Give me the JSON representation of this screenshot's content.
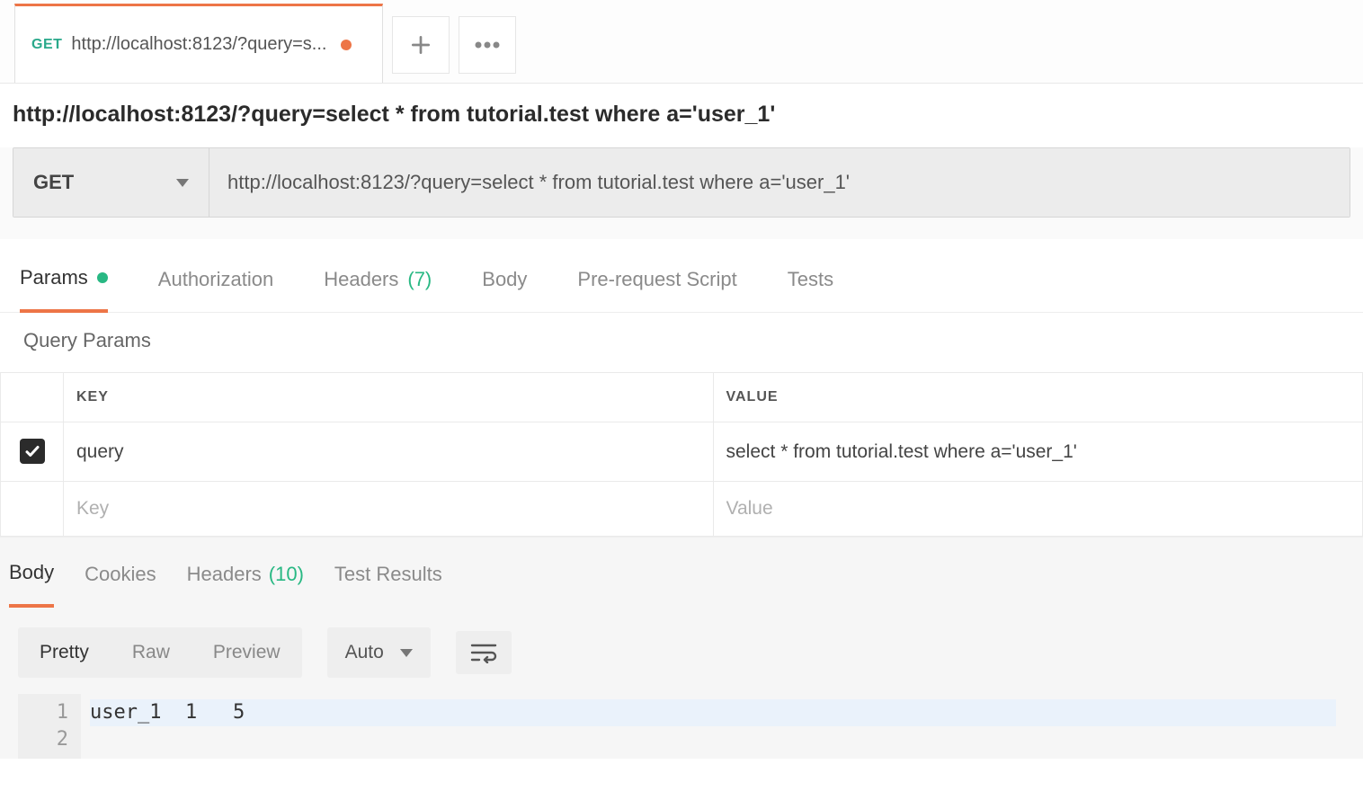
{
  "tab": {
    "method": "GET",
    "title": "http://localhost:8123/?query=s...",
    "unsaved": true
  },
  "request": {
    "url_display": "http://localhost:8123/?query=select * from tutorial.test where a='user_1'",
    "method": "GET",
    "url": "http://localhost:8123/?query=select * from tutorial.test where a='user_1'"
  },
  "req_tabs": {
    "params": "Params",
    "authorization": "Authorization",
    "headers": "Headers",
    "headers_count": "(7)",
    "body": "Body",
    "pre_request": "Pre-request Script",
    "tests": "Tests"
  },
  "query_params": {
    "section_title": "Query Params",
    "headers": {
      "key": "KEY",
      "value": "VALUE"
    },
    "rows": [
      {
        "enabled": true,
        "key": "query",
        "value": "select * from tutorial.test where a='user_1'"
      }
    ],
    "placeholder": {
      "key": "Key",
      "value": "Value"
    }
  },
  "resp_tabs": {
    "body": "Body",
    "cookies": "Cookies",
    "headers": "Headers",
    "headers_count": "(10)",
    "test_results": "Test Results"
  },
  "resp_toolbar": {
    "pretty": "Pretty",
    "raw": "Raw",
    "preview": "Preview",
    "format": "Auto"
  },
  "response_body": {
    "lines": [
      "user_1  1   5",
      ""
    ]
  }
}
